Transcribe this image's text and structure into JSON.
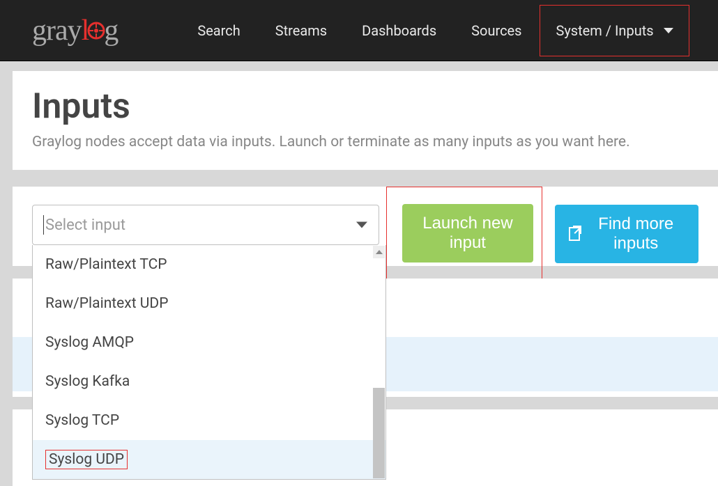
{
  "nav": {
    "items": [
      "Search",
      "Streams",
      "Dashboards",
      "Sources",
      "System / Inputs"
    ]
  },
  "page": {
    "title": "Inputs",
    "subtitle": "Graylog nodes accept data via inputs. Launch or terminate as many inputs as you want here."
  },
  "select": {
    "placeholder": "Select input",
    "options": [
      "Raw/Plaintext TCP",
      "Raw/Plaintext UDP",
      "Syslog AMQP",
      "Syslog Kafka",
      "Syslog TCP",
      "Syslog UDP"
    ]
  },
  "buttons": {
    "launch": "Launch new input",
    "find": "Find more inputs"
  }
}
